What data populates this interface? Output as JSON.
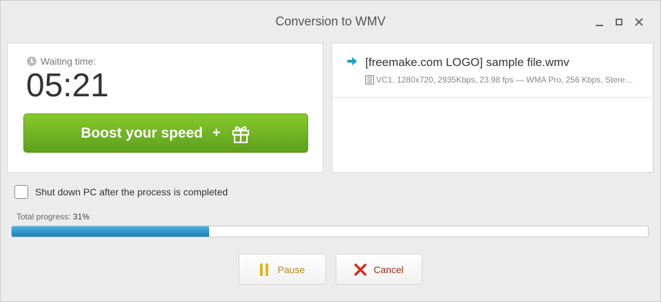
{
  "window": {
    "title": "Conversion to WMV"
  },
  "wait": {
    "label": "Waiting time:",
    "time": "05:21"
  },
  "boost": {
    "label": "Boost your speed",
    "plus": "+",
    "icon": "gift-icon"
  },
  "file": {
    "name": "[freemake.com LOGO] sample file.wmv",
    "meta": "VC1, 1280x720, 2935Kbps, 23.98 fps — WMA Pro, 256 Kbps, Stere…"
  },
  "shutdown": {
    "label": "Shut down PC after the process is completed",
    "checked": false
  },
  "progress": {
    "label": "Total progress:",
    "percent_text": "31%",
    "value": 0.31,
    "color": "#2a93c8"
  },
  "buttons": {
    "pause": "Pause",
    "cancel": "Cancel"
  },
  "colors": {
    "boost_green": "#6fb523",
    "arrow_teal": "#1aa0c8",
    "pause_yellow": "#e3b519",
    "cancel_red": "#d42a1e"
  }
}
